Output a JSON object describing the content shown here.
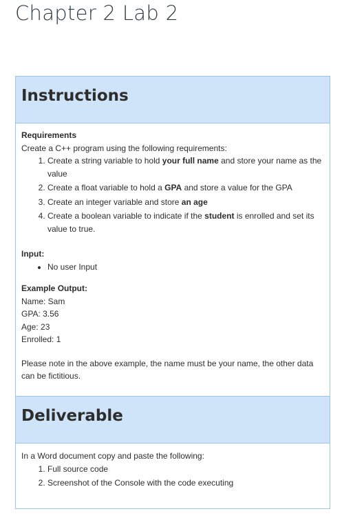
{
  "page": {
    "title": "Chapter 2 Lab 2"
  },
  "instructions": {
    "heading": "Instructions",
    "requirements_label": "Requirements",
    "intro": "Create a C++ program using the following requirements:",
    "items": [
      {
        "pre": "Create a string variable to hold ",
        "bold": "your full name",
        "post": " and store your name as the value"
      },
      {
        "pre": "Create a float variable to hold a ",
        "bold": "GPA",
        "post": " and store a value for the GPA"
      },
      {
        "pre": "Create an integer variable and store ",
        "bold": "an age",
        "post": ""
      },
      {
        "pre": "Create a boolean variable to indicate if the ",
        "bold": "student",
        "post": " is enrolled and set its value to true."
      }
    ],
    "input_label": "Input:",
    "input_items": [
      "No user Input"
    ],
    "example_label": "Example Output:",
    "example_lines": [
      "Name: Sam",
      "GPA: 3.56",
      "Age: 23",
      "Enrolled: 1"
    ],
    "note": "Please note in the above example, the name must be your name, the other data can be fictitious."
  },
  "deliverable": {
    "heading": "Deliverable",
    "intro": "In a Word document copy and paste the following:",
    "items": [
      "Full source code",
      "Screenshot of the Console with the code executing"
    ]
  },
  "colors": {
    "header_bg": "#cfe4f9",
    "border": "#9cc4e8"
  }
}
